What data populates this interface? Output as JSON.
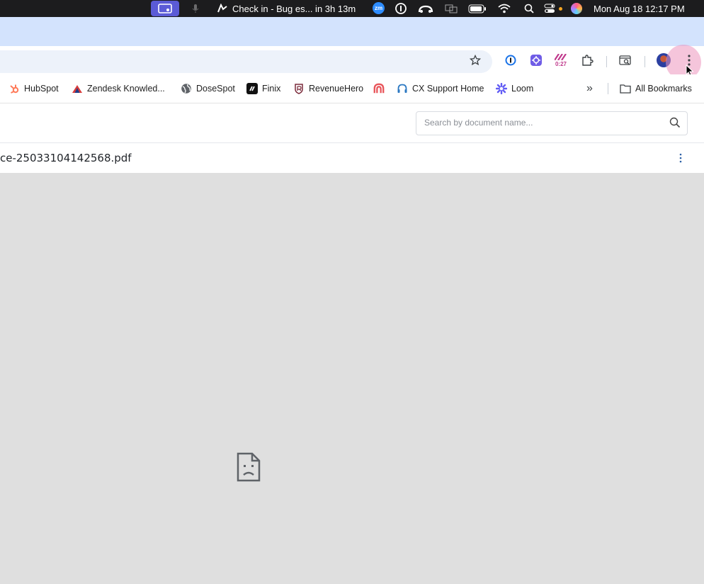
{
  "menubar": {
    "event_label": "Check in - Bug es... in 3h 13m",
    "zoom_label": "zm",
    "clock": "Mon Aug 18  12:17 PM"
  },
  "toolbar": {
    "timer_badge": "0:27"
  },
  "bookmarks": {
    "items": [
      {
        "label": "HubSpot",
        "icon": "hubspot-icon"
      },
      {
        "label": "Zendesk Knowled...",
        "icon": "zendesk-icon"
      },
      {
        "label": "DoseSpot",
        "icon": "globe-icon"
      },
      {
        "label": "Finix",
        "icon": "finix-icon"
      },
      {
        "label": "RevenueHero",
        "icon": "revenuehero-icon"
      },
      {
        "label": "",
        "icon": "arch-icon"
      },
      {
        "label": "CX Support Home",
        "icon": "headset-icon"
      },
      {
        "label": "Loom",
        "icon": "loom-icon"
      }
    ],
    "overflow": "»",
    "all_bookmarks": "All Bookmarks"
  },
  "page": {
    "search_placeholder": "Search by document name...",
    "document_title": "ce-25033104142568.pdf"
  },
  "colors": {
    "tabstrip": "#d3e3fd",
    "omnibox": "#edf2fa",
    "viewer_background": "#dfdfdf",
    "menu_highlight": "#ec96be"
  }
}
